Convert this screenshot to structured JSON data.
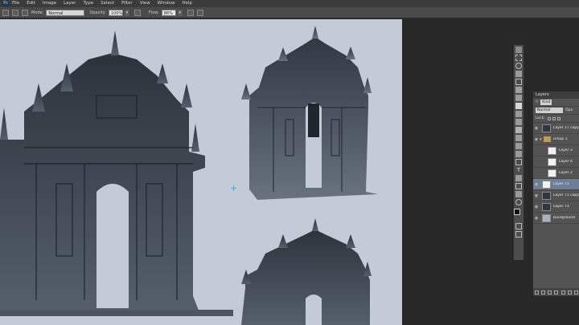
{
  "menubar": {
    "logo": "Ps",
    "items": [
      "File",
      "Edit",
      "Image",
      "Layer",
      "Type",
      "Select",
      "Filter",
      "View",
      "Window",
      "Help"
    ]
  },
  "options_bar": {
    "mode_label": "Mode:",
    "mode_value": "Normal",
    "opacity_label": "Opacity:",
    "opacity_value": "100%",
    "flow_label": "Flow:",
    "flow_value": "86%"
  },
  "layers_panel": {
    "title": "Layers",
    "kind_label": "Kind",
    "blend_mode": "Normal",
    "opacity_short": "Opa",
    "lock_label": "Lock:",
    "layers": [
      {
        "name": "Layer 17 copy",
        "type": "layer",
        "thumb": "dark",
        "indent": false,
        "selected": false
      },
      {
        "name": "Group 1",
        "type": "group",
        "thumb": "",
        "indent": false,
        "selected": false
      },
      {
        "name": "Layer 3",
        "type": "layer",
        "thumb": "light",
        "indent": true,
        "selected": false
      },
      {
        "name": "Layer 4",
        "type": "layer",
        "thumb": "light",
        "indent": true,
        "selected": false
      },
      {
        "name": "Layer 2",
        "type": "layer",
        "thumb": "light",
        "indent": true,
        "selected": false
      },
      {
        "name": "Layer 71",
        "type": "layer",
        "thumb": "light",
        "indent": false,
        "selected": true
      },
      {
        "name": "Layer 71 copy",
        "type": "layer",
        "thumb": "dark",
        "indent": false,
        "selected": false
      },
      {
        "name": "Layer 71",
        "type": "layer",
        "thumb": "dark",
        "indent": false,
        "selected": false
      },
      {
        "name": "Background",
        "type": "layer",
        "thumb": "grey",
        "indent": false,
        "selected": false
      }
    ]
  },
  "colors": {
    "canvas": "#c3ccd6",
    "building": "#3a424c",
    "building_light": "#58616c",
    "selection": "#6b7f99"
  }
}
